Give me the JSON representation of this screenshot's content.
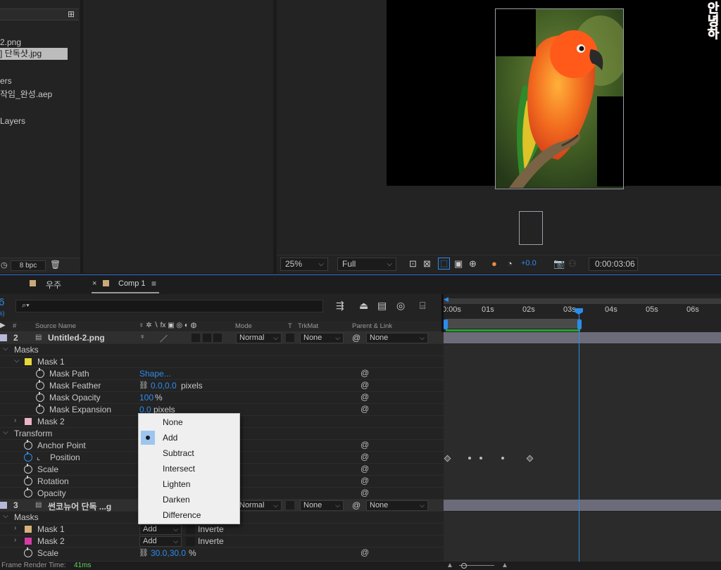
{
  "project": {
    "rows": [
      {
        "label": "2.png"
      },
      {
        "label": "] 단독샷.jpg",
        "selected": true
      },
      {
        "label": "ers"
      },
      {
        "label": "작임_완성.aep"
      },
      {
        "label": "Layers"
      }
    ],
    "bpc": "8 bpc",
    "icons": {
      "flowchart": "flowchart-icon",
      "trash": "trash-icon"
    }
  },
  "viewer": {
    "zoom": "25%",
    "resolution": "Full",
    "exposure": "+0.0",
    "timecode": "0:00:03:06",
    "overlay_text": "안녕하"
  },
  "timeline": {
    "tabs": [
      {
        "label": "우주"
      },
      {
        "label": "Comp 1",
        "active": true
      }
    ],
    "current_time_short": "6",
    "fps_hint": "s)",
    "search_placeholder": "",
    "columns": {
      "num": "#",
      "source": "Source Name",
      "switches": "♀ ✲ ∖ fx ▣ ◎ ◐ ◍",
      "mode": "Mode",
      "t": "T",
      "trkmat": "TrkMat",
      "parent": "Parent & Link"
    },
    "ruler": [
      "0:00s",
      "01s",
      "02s",
      "03s",
      "04s",
      "05s",
      "06s"
    ],
    "layers_rows": [
      {
        "kind": "layer",
        "num": "2",
        "name": "Untitled-2.png",
        "mode": "Normal",
        "trkmat": "None",
        "parent": "None"
      },
      {
        "kind": "group",
        "label": "Masks"
      },
      {
        "kind": "mask",
        "label": "Mask 1"
      },
      {
        "kind": "prop",
        "label": "Mask Path",
        "value": "Shape..."
      },
      {
        "kind": "prop",
        "label": "Mask Feather",
        "value": "0.0,0.0",
        "unit": "pixels"
      },
      {
        "kind": "prop",
        "label": "Mask Opacity",
        "value": "100",
        "unit": "%"
      },
      {
        "kind": "prop",
        "label": "Mask Expansion",
        "value": "0.0",
        "unit": "pixels"
      },
      {
        "kind": "mask",
        "label": "Mask 2"
      },
      {
        "kind": "group",
        "label": "Transform"
      },
      {
        "kind": "prop",
        "label": "Anchor Point"
      },
      {
        "kind": "prop",
        "label": "Position"
      },
      {
        "kind": "prop",
        "label": "Scale"
      },
      {
        "kind": "prop",
        "label": "Rotation"
      },
      {
        "kind": "prop",
        "label": "Opacity"
      },
      {
        "kind": "layer",
        "num": "3",
        "name": "썬코뉴어 단독 ...g",
        "mode": "Normal",
        "trkmat": "None",
        "parent": "None"
      },
      {
        "kind": "group",
        "label": "Masks"
      },
      {
        "kind": "mask",
        "label": "Mask 1",
        "mode": "Add",
        "inverted": "Inverte"
      },
      {
        "kind": "mask",
        "label": "Mask 2",
        "mode": "Add",
        "inverted": "Inverte"
      },
      {
        "kind": "prop",
        "label": "Scale",
        "value": "30.0,30.0",
        "unit": "%"
      }
    ],
    "status": {
      "label": "Frame Render Time:",
      "value": "41ms"
    }
  },
  "mode_menu": {
    "items": [
      "None",
      "Add",
      "Subtract",
      "Intersect",
      "Lighten",
      "Darken",
      "Difference"
    ],
    "selected": "Add"
  },
  "colors": {
    "accent": "#2d8ceb",
    "mask1": "#e6d83a",
    "mask2": "#e8b4c8",
    "mask2_layer3": "#d63aa4",
    "mask1_layer3": "#d8b27a",
    "layer_bar": "#6b6b7a",
    "work_area": "#25a12f"
  }
}
